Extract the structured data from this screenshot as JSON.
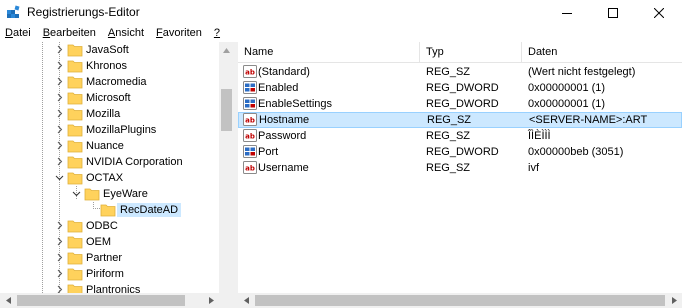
{
  "window": {
    "title": "Registrierungs-Editor",
    "controls": [
      "minimize",
      "maximize",
      "close"
    ]
  },
  "menu": [
    {
      "label_rest": "atei",
      "label_key": "D"
    },
    {
      "label_rest": "earbeiten",
      "label_key": "B"
    },
    {
      "label_rest": "nsicht",
      "label_key": "A"
    },
    {
      "label_rest": "avoriten",
      "label_key": "F"
    },
    {
      "label_rest": "",
      "label_key": "?"
    }
  ],
  "tree": {
    "items": [
      {
        "label": "JavaSoft",
        "expandable": true
      },
      {
        "label": "Khronos",
        "expandable": true
      },
      {
        "label": "Macromedia",
        "expandable": true
      },
      {
        "label": "Microsoft",
        "expandable": true
      },
      {
        "label": "Mozilla",
        "expandable": true
      },
      {
        "label": "MozillaPlugins",
        "expandable": true
      },
      {
        "label": "Nuance",
        "expandable": true
      },
      {
        "label": "NVIDIA Corporation",
        "expandable": true
      },
      {
        "label": "OCTAX",
        "expanded": true
      },
      {
        "label": "EyeWare",
        "expanded": true
      },
      {
        "label": "RecDateAD",
        "selected": true
      },
      {
        "label": "ODBC",
        "expandable": true
      },
      {
        "label": "OEM",
        "expandable": true
      },
      {
        "label": "Partner",
        "expandable": true
      },
      {
        "label": "Piriform",
        "expandable": true
      },
      {
        "label": "Plantronics",
        "expandable": true
      }
    ]
  },
  "list": {
    "columns": {
      "name": "Name",
      "type": "Typ",
      "data": "Daten"
    },
    "rows": [
      {
        "name": "(Standard)",
        "type": "REG_SZ",
        "data": "(Wert nicht festgelegt)",
        "icon": "string-value-icon"
      },
      {
        "name": "Enabled",
        "type": "REG_DWORD",
        "data": "0x00000001 (1)",
        "icon": "dword-value-icon"
      },
      {
        "name": "EnableSettings",
        "type": "REG_DWORD",
        "data": "0x00000001 (1)",
        "icon": "dword-value-icon"
      },
      {
        "name": "Hostname",
        "type": "REG_SZ",
        "data": "<SERVER-NAME>:ART",
        "icon": "string-value-icon",
        "selected": true
      },
      {
        "name": "Password",
        "type": "REG_SZ",
        "data": "ÎÌÈÌÌÌ",
        "icon": "string-value-icon"
      },
      {
        "name": "Port",
        "type": "REG_DWORD",
        "data": "0x00000beb (3051)",
        "icon": "dword-value-icon"
      },
      {
        "name": "Username",
        "type": "REG_SZ",
        "data": "ivf",
        "icon": "string-value-icon"
      }
    ]
  },
  "colors": {
    "selection": "#cce8ff",
    "selection_border": "#99d1ff",
    "folder": "#ffd25c",
    "scrollbar_track": "#f0f0f0",
    "scrollbar_thumb": "#c2c2c2"
  }
}
